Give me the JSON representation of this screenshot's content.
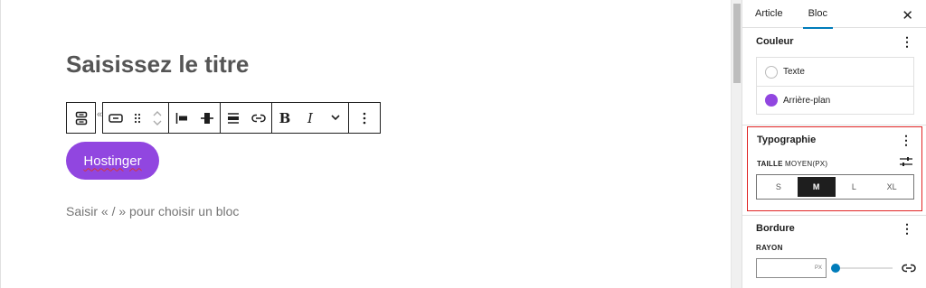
{
  "editor": {
    "title_placeholder": "Saisissez le titre",
    "button_text": "Hostinger",
    "block_hint": "Saisir « / » pour choisir un bloc",
    "collapse_marker": "«"
  },
  "toolbar": {
    "bold": "B",
    "italic": "I"
  },
  "sidebar": {
    "tabs": [
      {
        "label": "Article",
        "active": false
      },
      {
        "label": "Bloc",
        "active": true
      }
    ],
    "close": "✕",
    "color": {
      "heading": "Couleur",
      "items": [
        {
          "label": "Texte",
          "swatch": "none"
        },
        {
          "label": "Arrière-plan",
          "swatch": "#9146e0"
        }
      ]
    },
    "typography": {
      "heading": "Typographie",
      "size_label": "TAILLE",
      "size_value": "MOYEN(PX)",
      "sizes": [
        "S",
        "M",
        "L",
        "XL"
      ],
      "selected_size": "M"
    },
    "border": {
      "heading": "Bordure",
      "radius_label": "RAYON",
      "radius_unit": "PX",
      "radius_slider_level": 0
    }
  },
  "colors": {
    "accent": "#9146e0",
    "wp_blue": "#007cba",
    "highlight": "#e02424"
  }
}
